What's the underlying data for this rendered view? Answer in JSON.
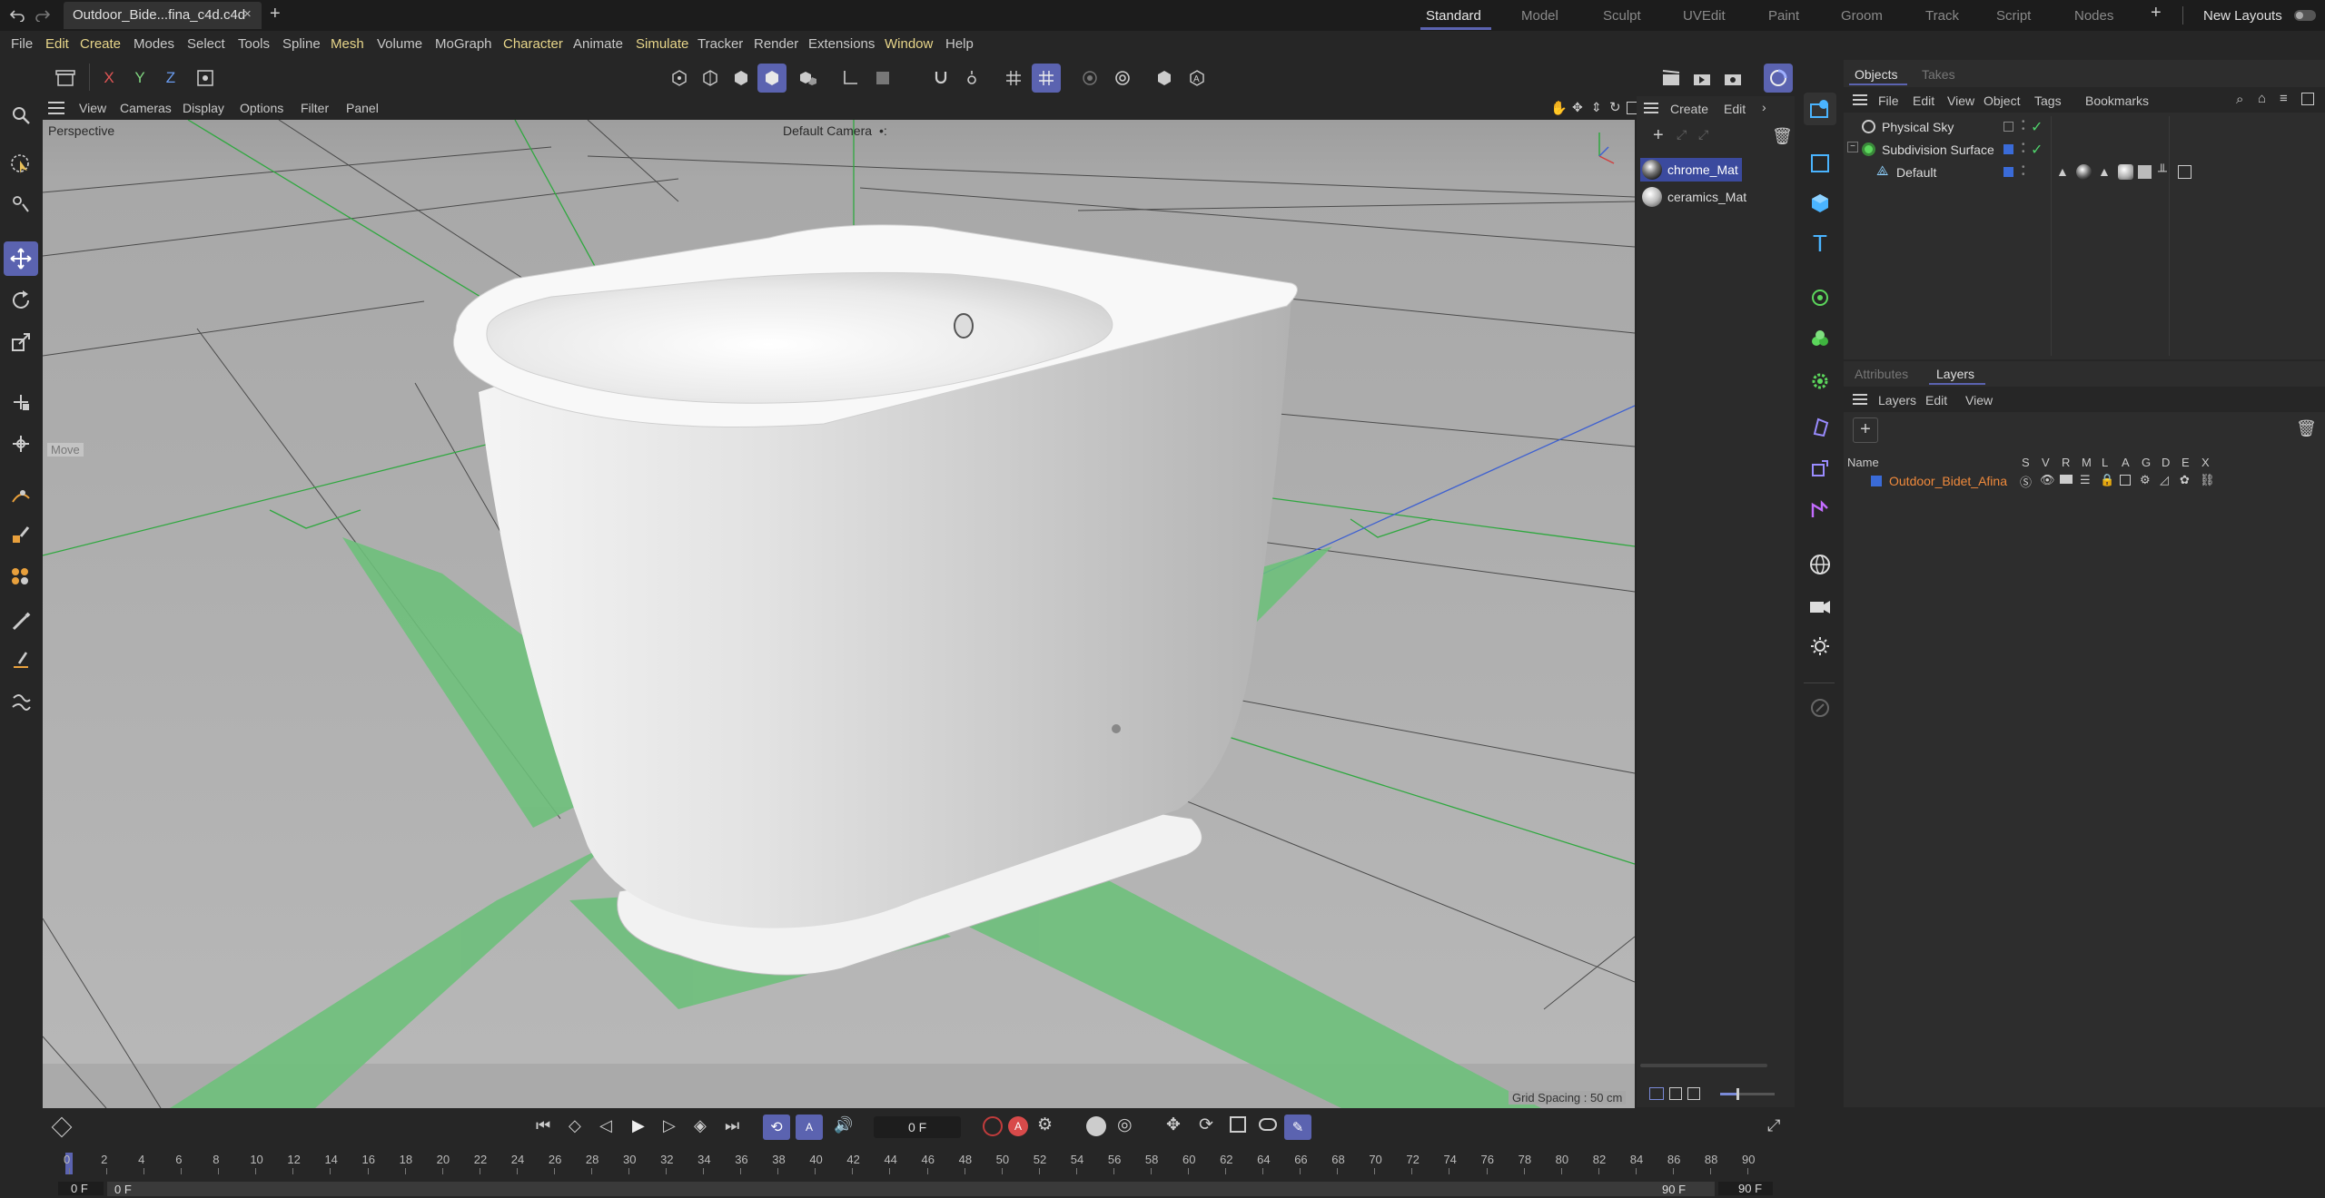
{
  "window": {
    "tab_title": "Outdoor_Bide...fina_c4d.c4d",
    "add_tab": "+",
    "layouts": [
      "Standard",
      "Model",
      "Sculpt",
      "UVEdit",
      "Paint",
      "Groom",
      "Track",
      "Script",
      "Nodes"
    ],
    "active_layout": "Standard",
    "new_layouts": "New Layouts"
  },
  "menu": [
    "File",
    "Edit",
    "Create",
    "Modes",
    "Select",
    "Tools",
    "Spline",
    "Mesh",
    "Volume",
    "MoGraph",
    "Character",
    "Animate",
    "Simulate",
    "Tracker",
    "Render",
    "Extensions",
    "Window",
    "Help"
  ],
  "axis_toggles": [
    "X",
    "Y",
    "Z"
  ],
  "viewport": {
    "menu": [
      "View",
      "Cameras",
      "Display",
      "Options",
      "Filter",
      "Panel"
    ],
    "projection": "Perspective",
    "camera": "Default Camera",
    "camera_suffix": "•:",
    "hud_move": "Move",
    "grid_spacing": "Grid Spacing : 50 cm"
  },
  "materials": {
    "menu": [
      "Create",
      "Edit"
    ],
    "items": [
      {
        "name": "chrome_Mat",
        "selected": true
      },
      {
        "name": "ceramics_Mat",
        "selected": false
      }
    ]
  },
  "objects": {
    "tabs": [
      "Objects",
      "Takes"
    ],
    "active_tab": "Objects",
    "menu": [
      "File",
      "Edit",
      "View",
      "Object",
      "Tags",
      "Bookmarks"
    ],
    "tree": [
      {
        "name": "Physical Sky",
        "level": 0,
        "icon": "sky-icon"
      },
      {
        "name": "Subdivision Surface",
        "level": 0,
        "icon": "subdivision-icon"
      },
      {
        "name": "Default",
        "level": 1,
        "icon": "polygon-icon"
      }
    ]
  },
  "layers": {
    "tabs": [
      "Attributes",
      "Layers"
    ],
    "active_tab": "Layers",
    "menu": [
      "Layers",
      "Edit",
      "View"
    ],
    "columns": [
      "Name",
      "S",
      "V",
      "R",
      "M",
      "L",
      "A",
      "G",
      "D",
      "E",
      "X"
    ],
    "rows": [
      {
        "name": "Outdoor_Bidet_Afina",
        "color": "#3a6bd8"
      }
    ]
  },
  "timeline": {
    "current_frame": "0 F",
    "start_frame": "0 F",
    "start_frame2": "0 F",
    "end_frame": "90 F",
    "end_frame2": "90 F",
    "ticks": [
      "0",
      "2",
      "4",
      "6",
      "8",
      "10",
      "12",
      "14",
      "16",
      "18",
      "20",
      "22",
      "24",
      "26",
      "28",
      "30",
      "32",
      "34",
      "36",
      "38",
      "40",
      "42",
      "44",
      "46",
      "48",
      "50",
      "52",
      "54",
      "56",
      "58",
      "60",
      "62",
      "64",
      "66",
      "68",
      "70",
      "72",
      "74",
      "76",
      "78",
      "80",
      "82",
      "84",
      "86",
      "88",
      "90"
    ]
  },
  "colors": {
    "accent": "#5b63b0",
    "selection": "#3b4a9e",
    "layer_text": "#f08a3c",
    "green_check": "#4fd16b"
  }
}
